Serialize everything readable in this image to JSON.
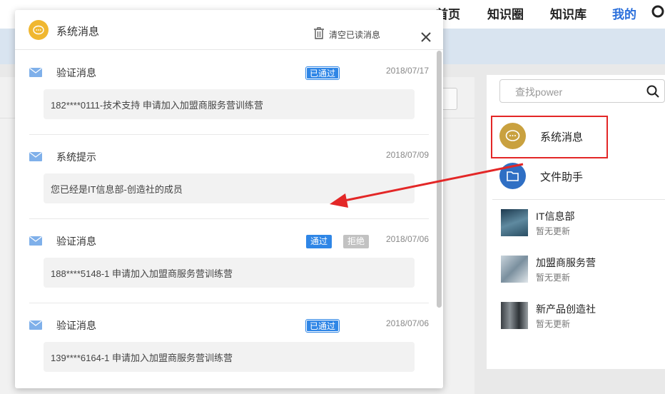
{
  "topnav": {
    "items": [
      "首页",
      "知识圈",
      "知识库",
      "我的"
    ],
    "active_index": 3
  },
  "sidebar": {
    "search_placeholder": "查找power",
    "items": [
      {
        "label": "系统消息",
        "icon": "chat-bubble-icon",
        "color": "#c9a13f"
      },
      {
        "label": "文件助手",
        "icon": "folder-icon",
        "color": "#2f6fc4"
      }
    ],
    "groups": [
      {
        "name": "IT信息部",
        "status": "暂无更新"
      },
      {
        "name": "加盟商服务营",
        "status": "暂无更新"
      },
      {
        "name": "新产品创造社",
        "status": "暂无更新"
      }
    ]
  },
  "modal": {
    "title": "系统消息",
    "clear_label": "清空已读消息",
    "messages": [
      {
        "type": "验证消息",
        "date": "2018/07/17",
        "badges": [
          "已通过"
        ],
        "body": "182****0111-技术支持 申请加入加盟商服务营训练营"
      },
      {
        "type": "系统提示",
        "date": "2018/07/09",
        "badges": [],
        "body": "您已经是IT信息部-创造社的成员"
      },
      {
        "type": "验证消息",
        "date": "2018/07/06",
        "badges": [
          "通过",
          "拒绝"
        ],
        "body": "188****5148-1 申请加入加盟商服务营训练营"
      },
      {
        "type": "验证消息",
        "date": "2018/07/06",
        "badges": [
          "已通过"
        ],
        "body": "139****6164-1 申请加入加盟商服务营训练营"
      }
    ]
  },
  "colors": {
    "accent": "#2f86e6",
    "highlight_border": "#e32727",
    "arrow": "#e32727"
  }
}
